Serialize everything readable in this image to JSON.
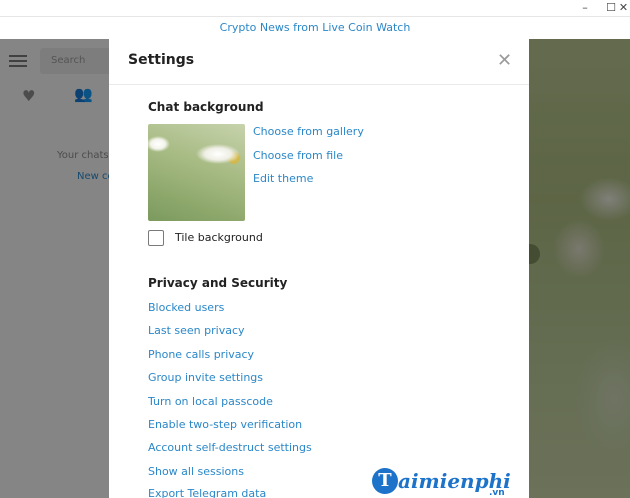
{
  "window": {
    "controls": {
      "minimize": "–",
      "maximize": "☐",
      "close": "✕"
    }
  },
  "banner": {
    "text": "Crypto News from Live Coin Watch"
  },
  "sidebar": {
    "menu_icon": "hamburger-icon",
    "search_placeholder": "Search",
    "tabs": [
      {
        "icon": "heart-icon",
        "glyph": "♥"
      },
      {
        "icon": "contacts-icon",
        "glyph": "👥"
      }
    ],
    "empty_text": "Your chats",
    "new_chat_text": "New co"
  },
  "settings": {
    "title": "Settings",
    "close_glyph": "✕",
    "chat_background": {
      "title": "Chat background",
      "links": [
        {
          "label": "Choose from gallery"
        },
        {
          "label": "Choose from file"
        },
        {
          "label": "Edit theme"
        }
      ],
      "tile_label": "Tile background",
      "tile_checked": false
    },
    "privacy": {
      "title": "Privacy and Security",
      "links": [
        {
          "label": "Blocked users"
        },
        {
          "label": "Last seen privacy"
        },
        {
          "label": "Phone calls privacy"
        },
        {
          "label": "Group invite settings"
        },
        {
          "label": "Turn on local passcode"
        },
        {
          "label": "Enable two-step verification"
        },
        {
          "label": "Account self-destruct settings"
        },
        {
          "label": "Show all sessions"
        },
        {
          "label": "Export Telegram data"
        }
      ]
    }
  },
  "watermark": {
    "letter": "T",
    "text": "aimienphi",
    "suffix": ".vn"
  },
  "colors": {
    "accent": "#2a87c8",
    "overlay": "rgba(0,0,0,0.45)"
  }
}
